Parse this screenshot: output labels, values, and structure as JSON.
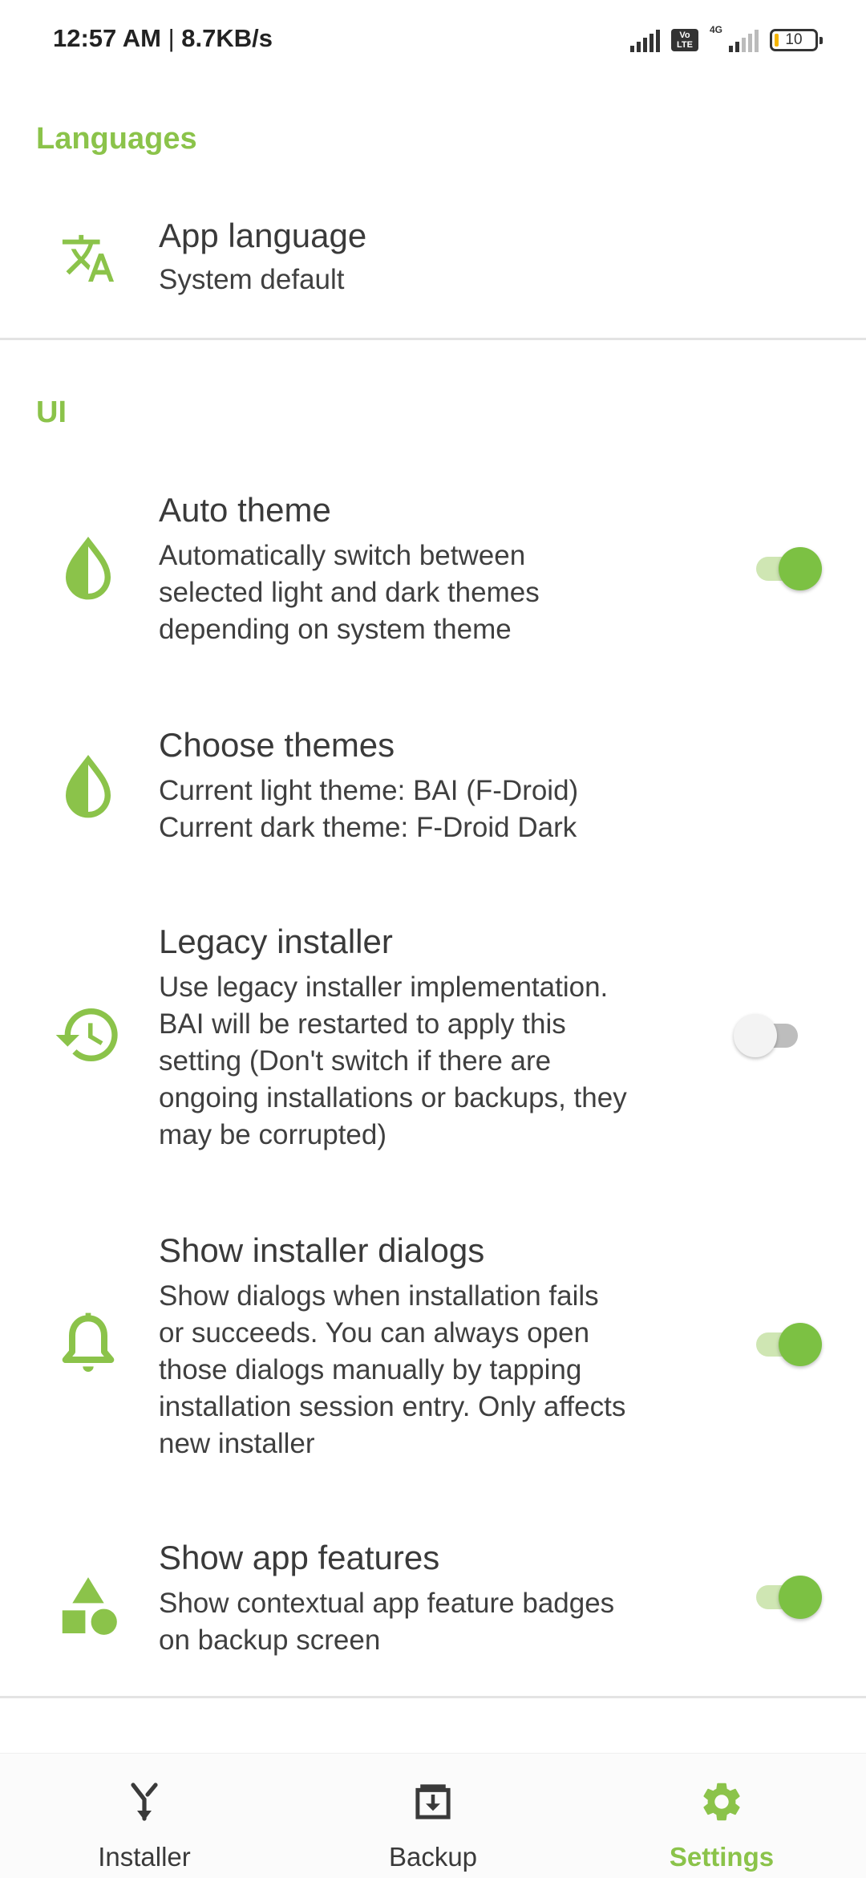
{
  "status_bar": {
    "time": "12:57 AM",
    "speed": "8.7KB/s",
    "volte_label": "Vo LTE",
    "network_label": "4G",
    "battery_level": "10"
  },
  "sections": {
    "languages": {
      "header": "Languages"
    },
    "ui": {
      "header": "UI"
    }
  },
  "prefs": {
    "app_language": {
      "title": "App language",
      "summary": "System default",
      "icon": "translate-icon"
    },
    "auto_theme": {
      "title": "Auto theme",
      "summary": "Automatically switch between\nselected light and dark themes\ndepending on system theme",
      "icon": "theme-drop-icon",
      "enabled": true
    },
    "choose_themes": {
      "title": "Choose themes",
      "summary": "Current light theme: BAI (F-Droid)\nCurrent dark theme: F-Droid Dark",
      "icon": "theme-drop-icon"
    },
    "legacy_installer": {
      "title": "Legacy installer",
      "summary": "Use legacy installer implementation.\nBAI will be restarted to apply this\nsetting (Don't switch if there are\nongoing installations or backups, they\nmay be corrupted)",
      "icon": "history-icon",
      "enabled": false
    },
    "show_installer_dialogs": {
      "title": "Show installer dialogs",
      "summary": "Show dialogs when installation fails\nor succeeds. You can always open\nthose dialogs manually by tapping\ninstallation session entry. Only affects\nnew installer",
      "icon": "bell-icon",
      "enabled": true
    },
    "show_app_features": {
      "title": "Show app features",
      "summary": "Show contextual app feature badges\non backup screen",
      "icon": "shapes-icon",
      "enabled": true
    }
  },
  "bottom_nav": {
    "items": [
      {
        "label": "Installer",
        "icon": "installer-merge-icon"
      },
      {
        "label": "Backup",
        "icon": "backup-archive-icon"
      },
      {
        "label": "Settings",
        "icon": "settings-gear-icon"
      }
    ],
    "active": "Settings"
  },
  "colors": {
    "accent": "#8bc34a",
    "switch_on": "#7cc143",
    "switch_track_on": "#cfe6b3"
  }
}
